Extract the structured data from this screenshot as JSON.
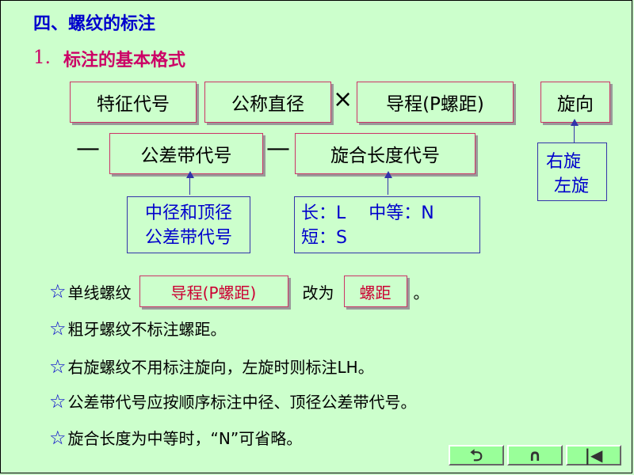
{
  "heading": "四、螺纹的标注",
  "subheading": {
    "number": "1.",
    "text": "标注的基本格式"
  },
  "format": {
    "row1": [
      "特征代号",
      "公称直径",
      "导程(P螺距)",
      "旋向"
    ],
    "times": "×",
    "dash": "—",
    "row2": [
      "公差带代号",
      "旋合长度代号"
    ]
  },
  "notes": {
    "direction": [
      "右旋",
      "左旋"
    ],
    "tolerance": [
      "中径和顶径",
      "公差带代号"
    ],
    "length": [
      "长：L　 中等：N",
      "短：S"
    ]
  },
  "rules": [
    {
      "before": "单线螺纹",
      "box1": "导程(P螺距)",
      "middle": "改为",
      "box2": "螺距",
      "after": "。"
    },
    {
      "text": "粗牙螺纹不标注螺距。"
    },
    {
      "text": "右旋螺纹不用标注旋向，左旋时则标注LH。"
    },
    {
      "text": "公差带代号应按顺序标注中径、顶径公差带代号。"
    },
    {
      "text": "旋合长度为中等时，“N”可省略。"
    }
  ],
  "star_symbol": "☆",
  "nav": [
    {
      "icon": "return-icon",
      "glyph": "⮌"
    },
    {
      "icon": "back-icon",
      "glyph": "∩"
    },
    {
      "icon": "first-page-icon",
      "glyph": "|◀"
    }
  ]
}
